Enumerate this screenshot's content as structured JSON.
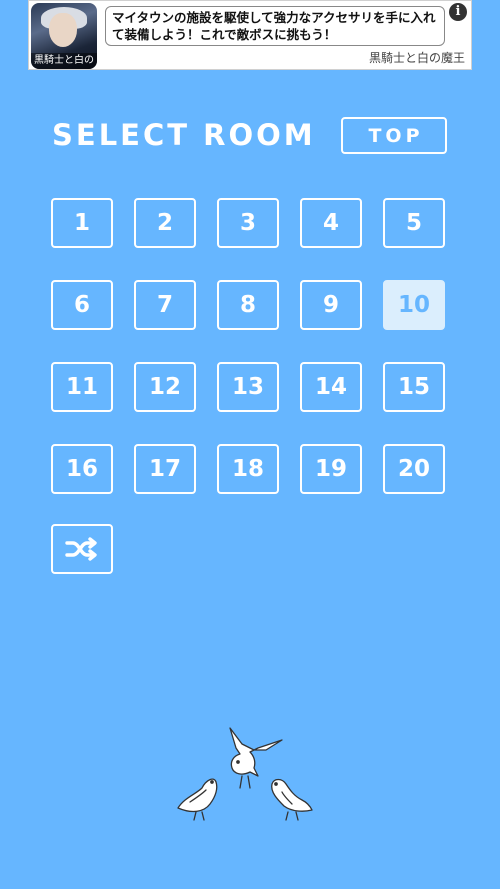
{
  "ad": {
    "thumbnail_caption": "黒騎士と白の魔王",
    "text": "マイタウンの施設を駆使して強力なアクセサリを手に入れて装備しよう！これで敵ボスに挑もう！",
    "info_label": "i",
    "source": "黒騎士と白の魔王"
  },
  "header": {
    "title": "SELECT ROOM",
    "top_button": "TOP"
  },
  "rooms": [
    "1",
    "2",
    "3",
    "4",
    "5",
    "6",
    "7",
    "8",
    "9",
    "10",
    "11",
    "12",
    "13",
    "14",
    "15",
    "16",
    "17",
    "18",
    "19",
    "20"
  ],
  "selected_room": "10",
  "shuffle_icon": "shuffle-icon",
  "decoration": "birds-illustration",
  "colors": {
    "background": "#66b6ff",
    "button_border": "#ffffff",
    "selected_fill": "#dbeefd"
  }
}
